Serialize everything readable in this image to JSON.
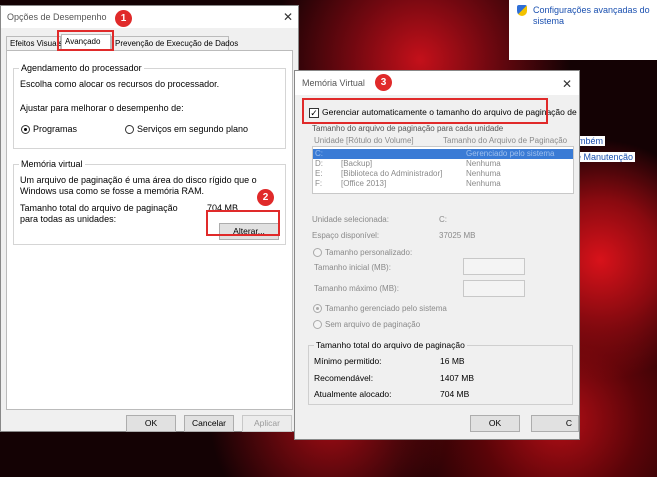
{
  "background": {
    "control_panel_link": "Configurações avançadas do sistema",
    "partial_link_1": "mbém",
    "partial_link_2": "e Manutenção"
  },
  "dialog1": {
    "title": "Opções de Desempenho",
    "tabs": [
      {
        "label": "Efeitos Visuais"
      },
      {
        "label": "Avançado"
      },
      {
        "label": "Prevenção de Execução de Dados"
      }
    ],
    "processor_group": {
      "title": "Agendamento do processador",
      "description": "Escolha como alocar os recursos do processador.",
      "adjust_label": "Ajustar para melhorar o desempenho de:",
      "option_programs": "Programas",
      "option_services": "Serviços em segundo plano"
    },
    "vm_group": {
      "title": "Memória virtual",
      "description_line1": "Um arquivo de paginação é uma área do disco rígido que o",
      "description_line2": "Windows usa como se fosse a memória RAM.",
      "total_label_line1": "Tamanho total do arquivo de paginação",
      "total_label_line2": "para todas as unidades:",
      "total_value": "704 MB",
      "change_button": "Alterar..."
    },
    "buttons": {
      "ok": "OK",
      "cancel": "Cancelar",
      "apply": "Aplicar"
    }
  },
  "dialog2": {
    "title": "Memória Virtual",
    "auto_manage_label": "Gerenciar automaticamente o tamanho do arquivo de paginação de",
    "auto_manage_checked": true,
    "drives_caption": "Tamanho do arquivo de paginação para cada unidade",
    "col_unit": "Unidade [Rótulo do Volume]",
    "col_size": "Tamanho do Arquivo de Paginação",
    "drives": [
      {
        "letter": "C:",
        "label": "",
        "size": "Gerenciado pelo sistema"
      },
      {
        "letter": "D:",
        "label": "[Backup]",
        "size": "Nenhuma"
      },
      {
        "letter": "E:",
        "label": "[Biblioteca do Administrador]",
        "size": "Nenhuma"
      },
      {
        "letter": "F:",
        "label": "[Office 2013]",
        "size": "Nenhuma"
      }
    ],
    "selected_unit_label": "Unidade selecionada:",
    "selected_unit_value": "C:",
    "free_space_label": "Espaço disponível:",
    "free_space_value": "37025 MB",
    "custom_size_label": "Tamanho personalizado:",
    "initial_size_label": "Tamanho inicial (MB):",
    "max_size_label": "Tamanho máximo (MB):",
    "system_managed_label": "Tamanho gerenciado pelo sistema",
    "no_paging_label": "Sem arquivo de paginação",
    "total_section_title": "Tamanho total do arquivo de paginação",
    "min_allowed_label": "Mínimo permitido:",
    "min_allowed_value": "16 MB",
    "recommended_label": "Recomendável:",
    "recommended_value": "1407 MB",
    "current_label": "Atualmente alocado:",
    "current_value": "704 MB",
    "ok_button": "OK",
    "cancel_partial": "C"
  },
  "annotations": {
    "badge1": "1",
    "badge2": "2",
    "badge3": "3",
    "color": "#e02a2a"
  }
}
